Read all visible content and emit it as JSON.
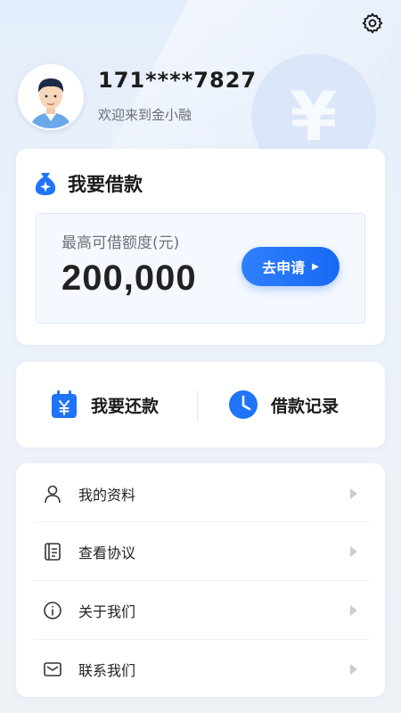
{
  "header": {
    "settings_icon": "gear-icon"
  },
  "user": {
    "phone": "171****7827",
    "welcome": "欢迎来到金小融",
    "avatar_icon": "user-avatar"
  },
  "background": {
    "coin_symbol": "¥"
  },
  "loan": {
    "title": "我要借款",
    "title_icon": "money-bag-icon",
    "quota_label": "最高可借额度(元)",
    "quota_value": "200,000",
    "apply_label": "去申请"
  },
  "actions": {
    "repay_label": "我要还款",
    "repay_icon": "calendar-yen-icon",
    "records_label": "借款记录",
    "records_icon": "clock-icon"
  },
  "menu": {
    "items": [
      {
        "label": "我的资料",
        "icon": "user-icon"
      },
      {
        "label": "查看协议",
        "icon": "document-icon"
      },
      {
        "label": "关于我们",
        "icon": "info-icon"
      },
      {
        "label": "联系我们",
        "icon": "mail-icon"
      }
    ]
  },
  "colors": {
    "accent": "#1f74f8",
    "background": "#eaf1fb",
    "card": "#ffffff",
    "text_primary": "#1a1a1a",
    "text_secondary": "#6b6f77"
  }
}
